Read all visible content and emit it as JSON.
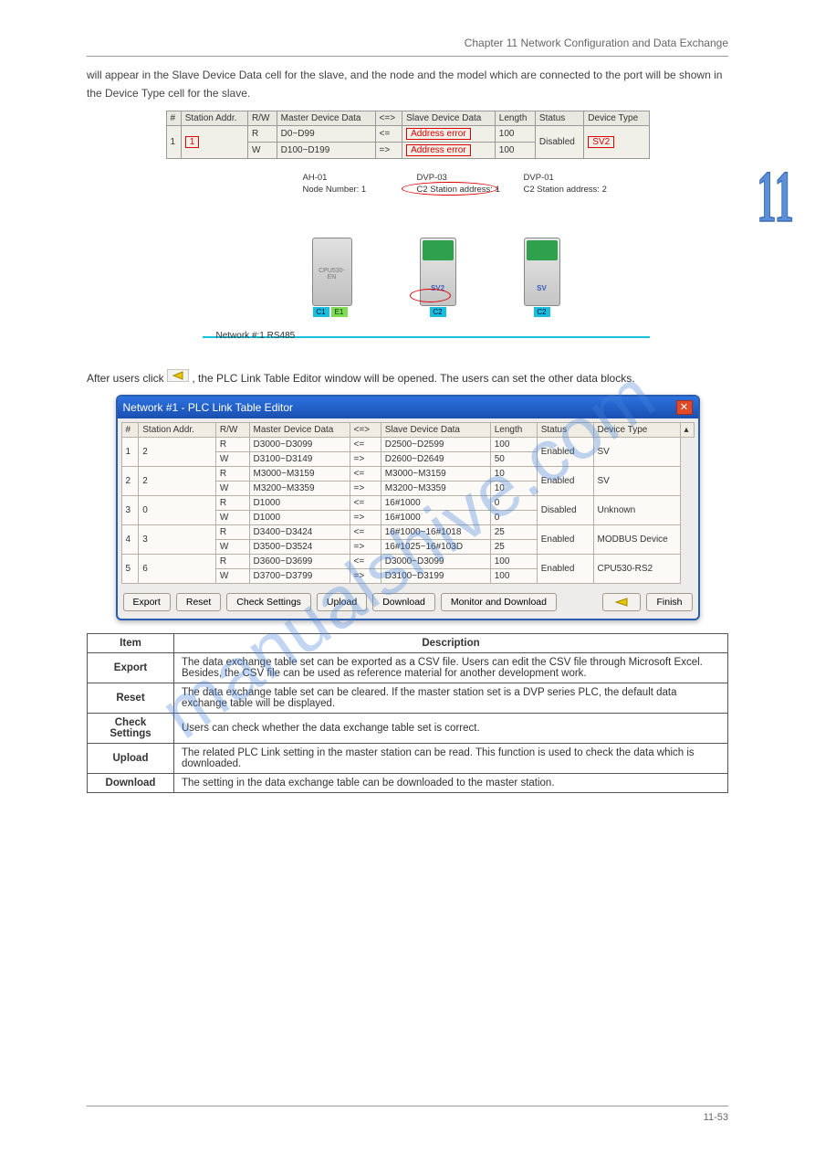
{
  "header": {
    "chapter_line": "Chapter 11 Network Configuration and Data Exchange"
  },
  "chapter_badge": "11",
  "intro": "will appear in the Slave Device Data cell for the slave, and the node and the model which are connected to the port will be shown in the Device Type cell for the slave.",
  "err_table": {
    "headers": [
      "#",
      "Station Addr.",
      "R/W",
      "Master Device Data",
      "<=>",
      "Slave Device Data",
      "Length",
      "Status",
      "Device Type"
    ],
    "rows": [
      {
        "num": "1",
        "addr": "1",
        "rw": "R",
        "mdd": "D0~D99",
        "dir": "<=",
        "sdd": "Address error",
        "len": "100",
        "status": "Disabled",
        "type": "SV2"
      },
      {
        "num": "",
        "addr": "",
        "rw": "W",
        "mdd": "D100~D199",
        "dir": "=>",
        "sdd": "Address error",
        "len": "100",
        "status": "",
        "type": ""
      }
    ]
  },
  "diagram": {
    "labels": {
      "ah": "AH-01",
      "ah_sub": "Node Number: 1",
      "d3": "DVP-03",
      "d3_sub": "C2 Station address: 1",
      "d1": "DVP-01",
      "d1_sub": "C2 Station address: 2"
    },
    "plc_name": "CPU530-EN",
    "plc_ports": {
      "c1": "C1",
      "e1": "E1"
    },
    "dvp_name1": "SV2",
    "dvp_name2": "SV",
    "c2": "C2",
    "netlabel": "Network #:1  RS485"
  },
  "midtext_before": "After users click ",
  "midtext_after": ", the PLC Link Table Editor window will be opened. The users can set the other data blocks.",
  "dialog": {
    "title": "Network #1 - PLC Link Table Editor",
    "headers": [
      "#",
      "Station Addr.",
      "R/W",
      "Master Device Data",
      "<=>",
      "Slave Device Data",
      "Length",
      "Status",
      "Device Type"
    ],
    "groups": [
      {
        "num": "1",
        "addr": "2",
        "status": "Enabled",
        "type": "SV",
        "rows": [
          {
            "rw": "R",
            "mdd": "D3000~D3099",
            "dir": "<=",
            "sdd": "D2500~D2599",
            "len": "100"
          },
          {
            "rw": "W",
            "mdd": "D3100~D3149",
            "dir": "=>",
            "sdd": "D2600~D2649",
            "len": "50"
          }
        ]
      },
      {
        "num": "2",
        "addr": "2",
        "status": "Enabled",
        "type": "SV",
        "rows": [
          {
            "rw": "R",
            "mdd": "M3000~M3159",
            "dir": "<=",
            "sdd": "M3000~M3159",
            "len": "10"
          },
          {
            "rw": "W",
            "mdd": "M3200~M3359",
            "dir": "=>",
            "sdd": "M3200~M3359",
            "len": "10"
          }
        ]
      },
      {
        "num": "3",
        "addr": "0",
        "status": "Disabled",
        "type": "Unknown",
        "rows": [
          {
            "rw": "R",
            "mdd": "D1000",
            "dir": "<=",
            "sdd": "16#1000",
            "len": "0"
          },
          {
            "rw": "W",
            "mdd": "D1000",
            "dir": "=>",
            "sdd": "16#1000",
            "len": "0"
          }
        ]
      },
      {
        "num": "4",
        "addr": "3",
        "status": "Enabled",
        "type": "MODBUS Device",
        "rows": [
          {
            "rw": "R",
            "mdd": "D3400~D3424",
            "dir": "<=",
            "sdd": "16#1000~16#1018",
            "len": "25"
          },
          {
            "rw": "W",
            "mdd": "D3500~D3524",
            "dir": "=>",
            "sdd": "16#1025~16#103D",
            "len": "25"
          }
        ]
      },
      {
        "num": "5",
        "addr": "6",
        "status": "Enabled",
        "type": "CPU530-RS2",
        "rows": [
          {
            "rw": "R",
            "mdd": "D3600~D3699",
            "dir": "<=",
            "sdd": "D3000~D3099",
            "len": "100"
          },
          {
            "rw": "W",
            "mdd": "D3700~D3799",
            "dir": "=>",
            "sdd": "D3100~D3199",
            "len": "100"
          }
        ]
      }
    ],
    "buttons": {
      "export": "Export",
      "reset": "Reset",
      "check": "Check Settings",
      "upload": "Upload",
      "download": "Download",
      "monitor": "Monitor and Download",
      "finish": "Finish"
    }
  },
  "desc_table": {
    "headers": [
      "Item",
      "Description"
    ],
    "rows": [
      [
        "Export",
        "The data exchange table set can be exported as a CSV file. Users can edit the CSV file through Microsoft Excel. Besides, the CSV file can be used as reference material for another development work."
      ],
      [
        "Reset",
        "The data exchange table set can be cleared. If the master station set is a DVP series PLC, the default data exchange table will be displayed."
      ],
      [
        "Check Settings",
        "Users can check whether the data exchange table set is correct."
      ],
      [
        "Upload",
        "The related PLC Link setting in the master station can be read. This function is used to check the data which is downloaded."
      ],
      [
        "Download",
        "The setting in the data exchange table can be downloaded to the master station."
      ]
    ]
  },
  "watermark": "manualshive.com",
  "footer": {
    "left": "",
    "right": "11-53"
  }
}
